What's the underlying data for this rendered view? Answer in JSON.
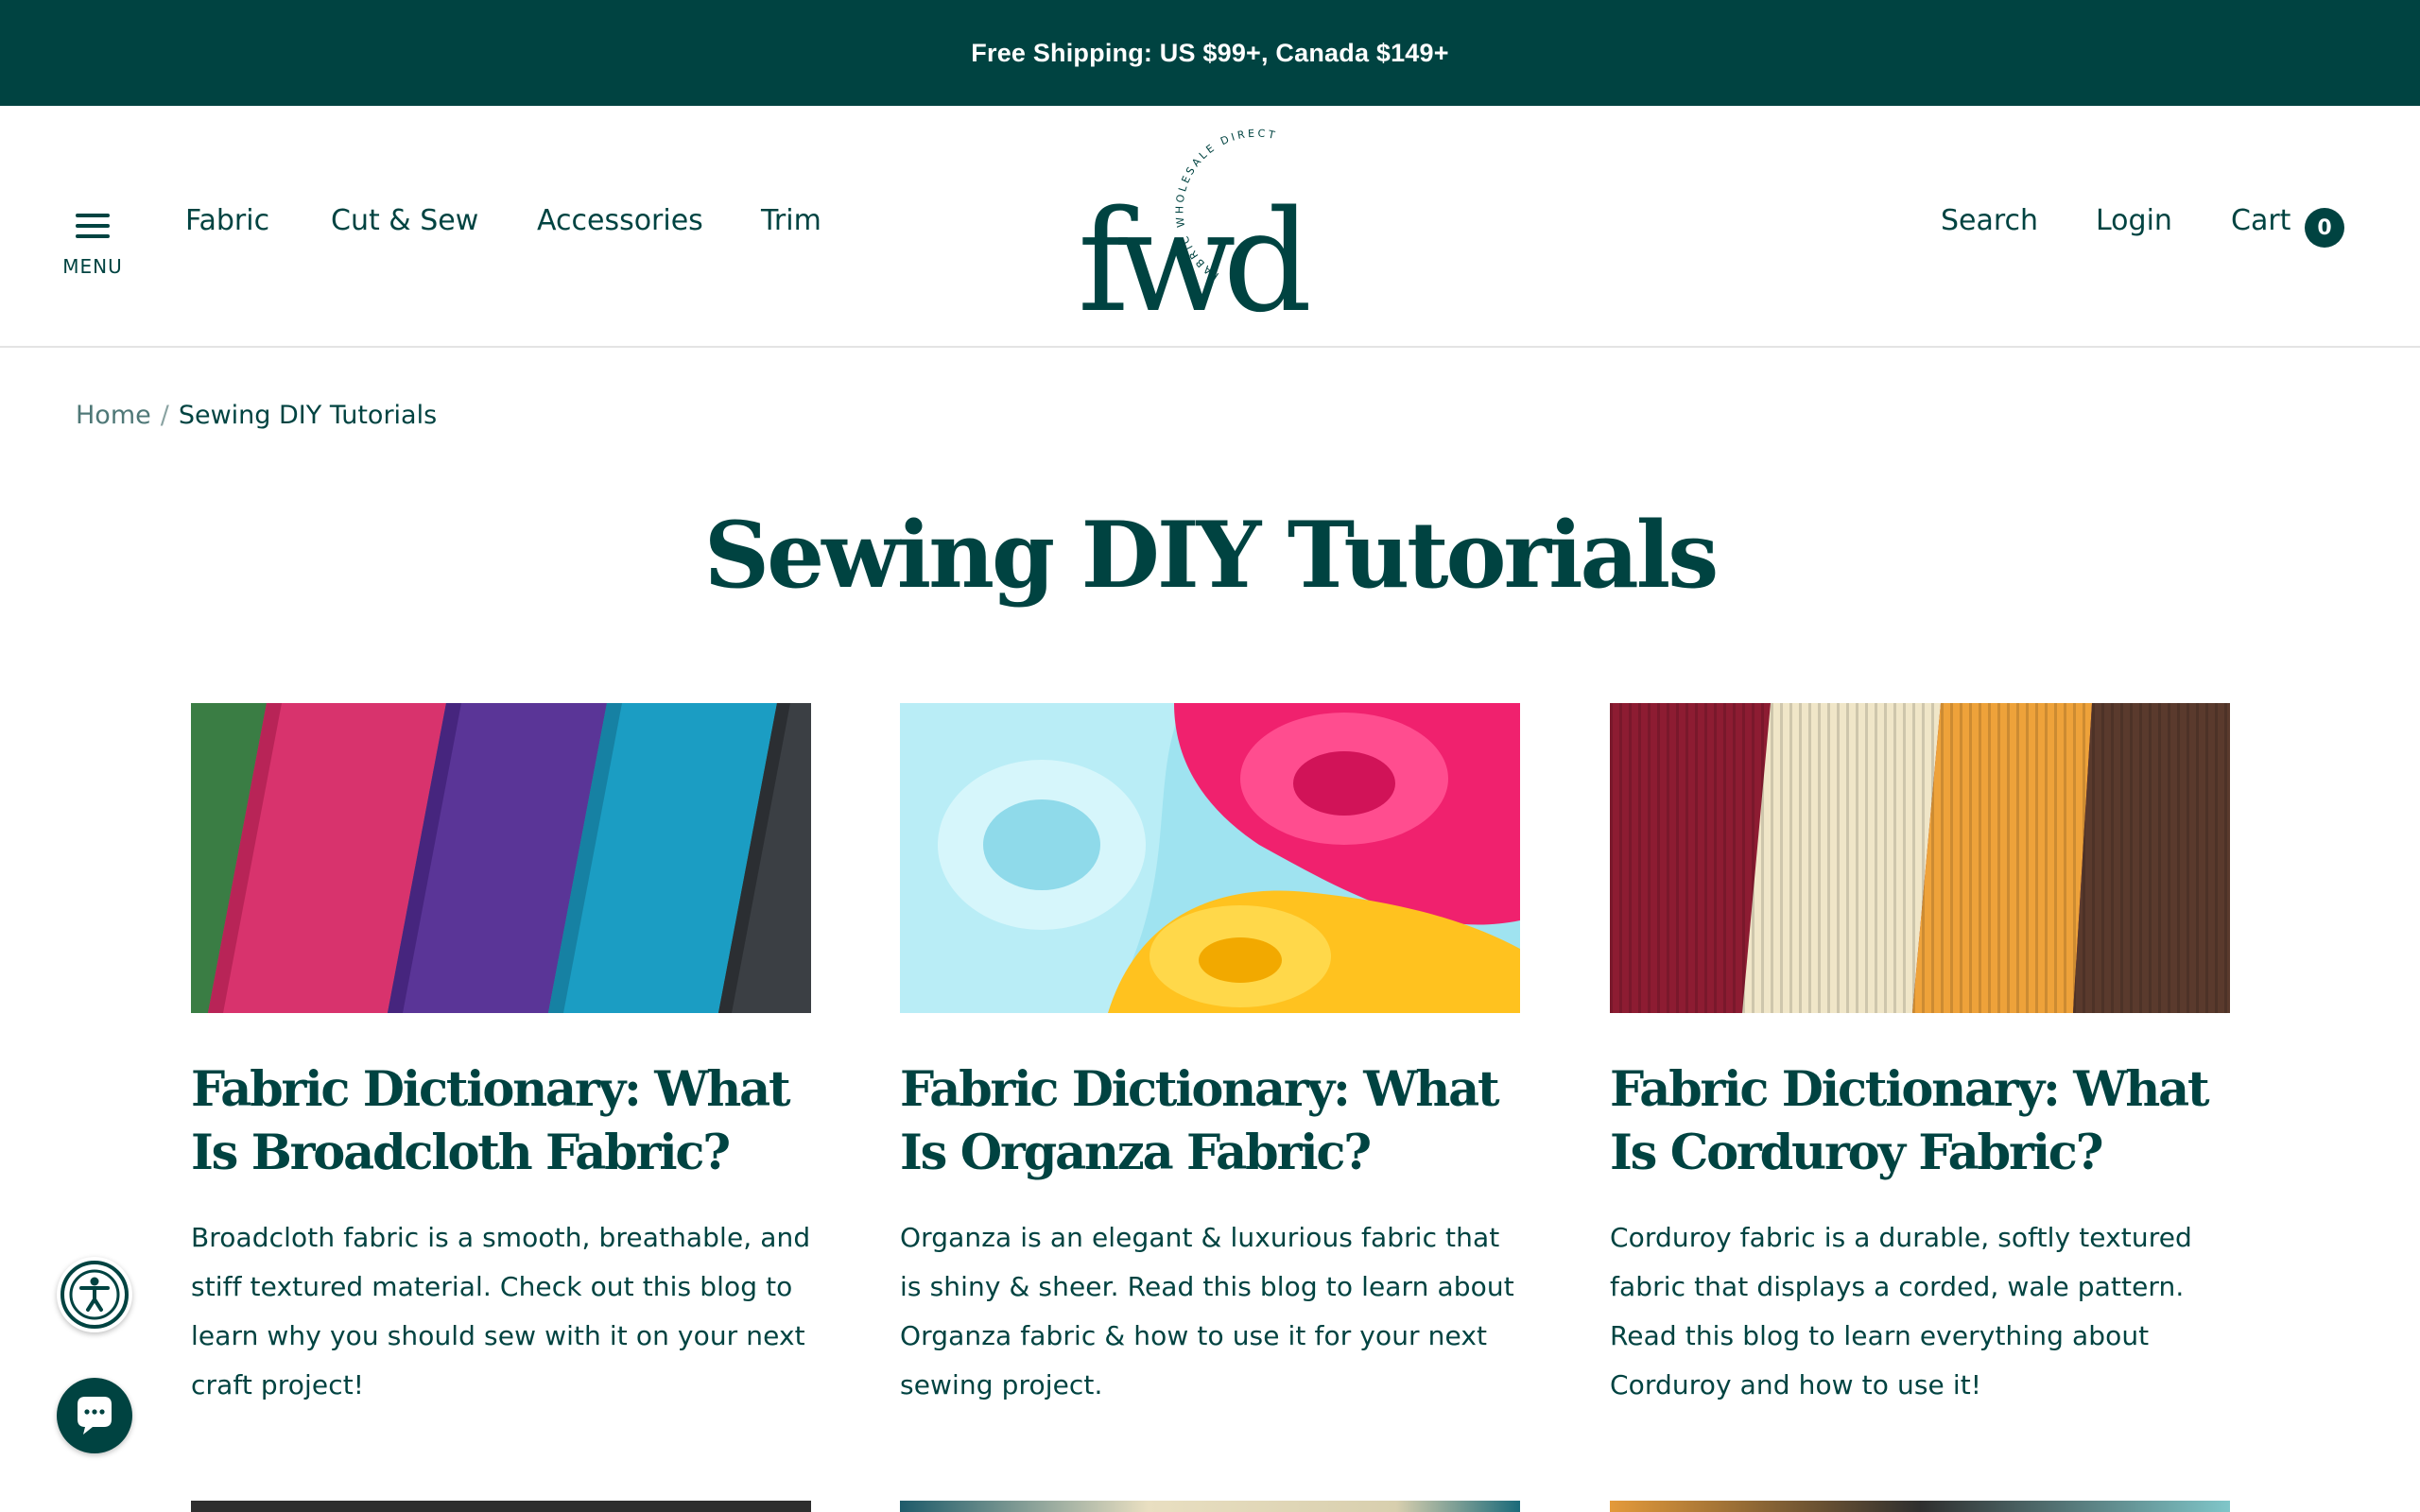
{
  "announcement": {
    "text": "Free Shipping: US $99+, Canada $149+"
  },
  "header": {
    "menu_label": "MENU",
    "nav": [
      "Fabric",
      "Cut & Sew",
      "Accessories",
      "Trim"
    ],
    "logo": {
      "wordmark": "fwd",
      "ring_text": "FABRIC WHOLESALE DIRECT"
    },
    "search_label": "Search",
    "login_label": "Login",
    "cart_label": "Cart",
    "cart_count": "0"
  },
  "breadcrumb": {
    "home": "Home",
    "separator": "/",
    "current": "Sewing DIY Tutorials"
  },
  "page": {
    "title": "Sewing DIY Tutorials"
  },
  "articles": [
    {
      "title": "Fabric Dictionary: What Is Broadcloth Fabric?",
      "excerpt": "Broadcloth fabric is a smooth, breathable, and stiff textured material. Check out this blog to learn why you should sew with it on your next craft project!"
    },
    {
      "title": "Fabric Dictionary: What Is Organza Fabric?",
      "excerpt": "Organza is an elegant & luxurious fabric that is shiny & sheer. Read this blog to learn about Organza fabric & how to use it for your next sewing project."
    },
    {
      "title": "Fabric Dictionary: What Is Corduroy Fabric?",
      "excerpt": "Corduroy fabric is a durable, softly textured fabric that displays a corded, wale pattern. Read this blog to learn everything about Corduroy and how to use it!"
    }
  ],
  "widgets": {
    "accessibility_icon": "accessibility-icon",
    "chat_icon": "chat-bubble-icon"
  },
  "colors": {
    "brand": "#004341",
    "text_muted": "#4f7877",
    "divider": "#e4e4e4"
  }
}
